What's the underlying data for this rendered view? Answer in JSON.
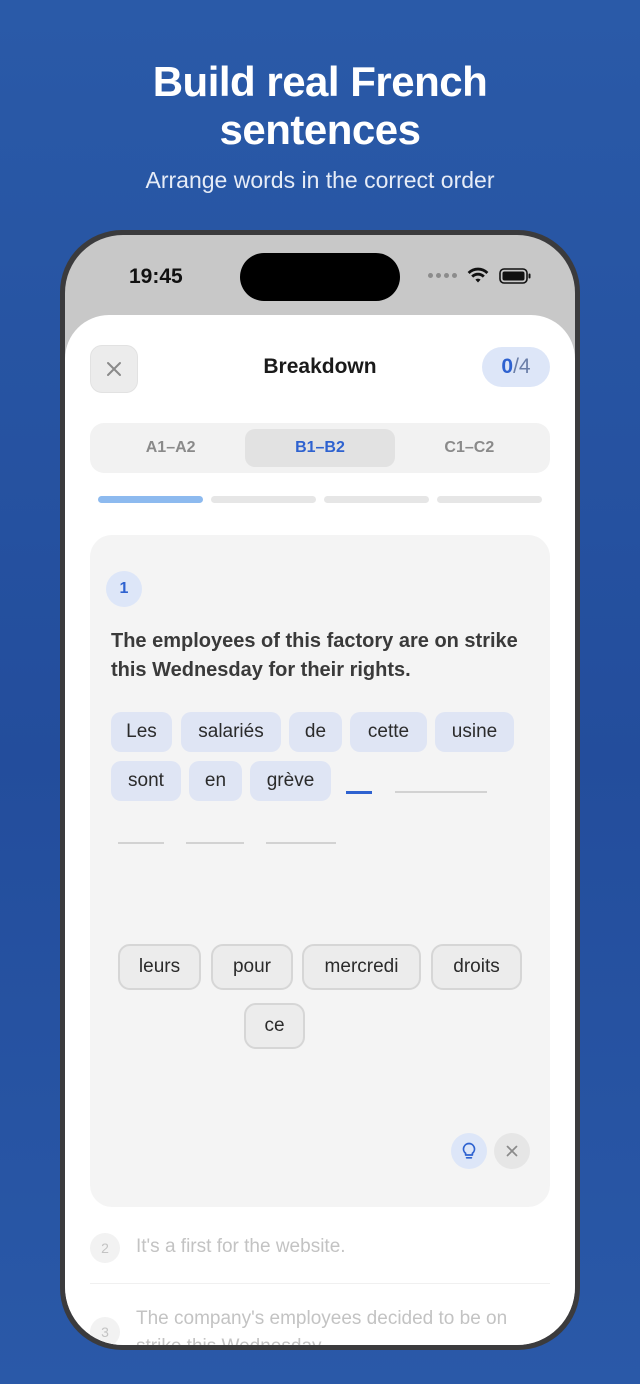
{
  "promo": {
    "headline_line1": "Build real French",
    "headline_line2": "sentences",
    "subheadline": "Arrange words in the correct order"
  },
  "status_bar": {
    "time": "19:45"
  },
  "header": {
    "title": "Breakdown",
    "score_current": "0",
    "score_total": "/4"
  },
  "levels": [
    {
      "label": "A1–A2",
      "active": false
    },
    {
      "label": "B1–B2",
      "active": true
    },
    {
      "label": "C1–C2",
      "active": false
    }
  ],
  "progress": {
    "segments": 4,
    "completed": 1
  },
  "exercise": {
    "number": "1",
    "prompt": "The employees of this factory are on strike this Wednesday for their rights.",
    "placed_words": [
      "Les",
      "salariés",
      "de",
      "cette",
      "usine",
      "sont",
      "en",
      "grève"
    ],
    "word_bank": [
      "leurs",
      "pour",
      "mercredi",
      "droits",
      "ce"
    ]
  },
  "upcoming": [
    {
      "number": "2",
      "text": "It's a first for the website."
    },
    {
      "number": "3",
      "text": "The company's employees decided to be on strike this Wednesday."
    }
  ],
  "icons": {
    "close": "close-icon",
    "hint": "lightbulb-icon",
    "skip": "x-icon"
  },
  "colors": {
    "accent": "#2e62d0",
    "background": "#234d9c"
  }
}
